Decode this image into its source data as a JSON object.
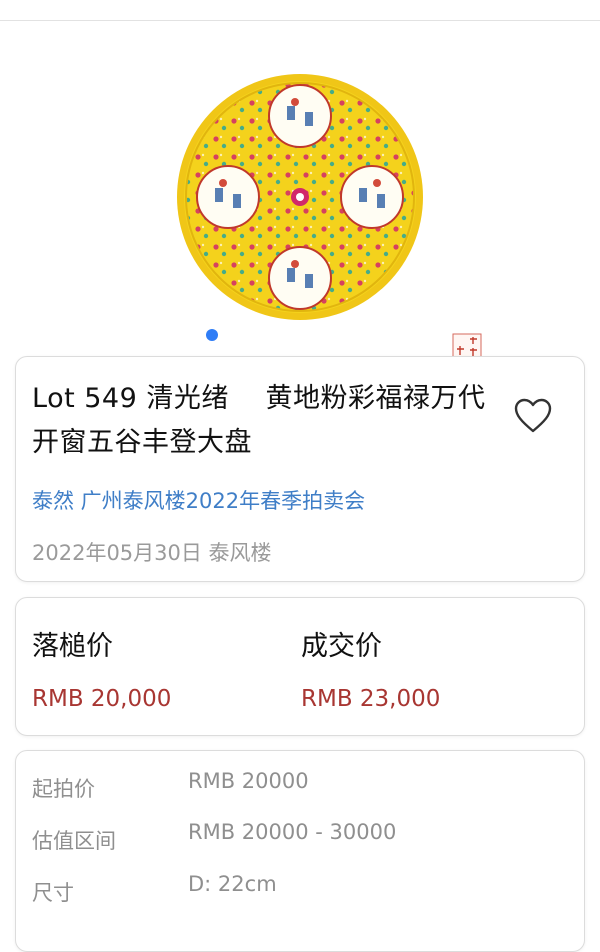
{
  "carousel": {
    "image_icon": "porcelain-plate-image",
    "seal_icon": "reign-mark-seal"
  },
  "lot": {
    "title": "Lot 549 清光绪　 黄地粉彩福禄万代开窗五谷丰登大盘",
    "auction_name": "泰然 广州泰风楼2022年春季拍卖会",
    "date_house": "2022年05月30日 泰风楼",
    "favorite_icon": "heart-icon"
  },
  "prices": {
    "hammer_label": "落槌价",
    "hammer_value": "RMB 20,000",
    "deal_label": "成交价",
    "deal_value": "RMB 23,000",
    "value_color": "#a83632"
  },
  "details": {
    "rows": [
      {
        "label": "起拍价",
        "value": "RMB 20000"
      },
      {
        "label": "估值区间",
        "value": "RMB 20000 - 30000"
      },
      {
        "label": "尺寸",
        "value": "D: 22cm"
      }
    ]
  },
  "colors": {
    "link": "#3f7ec7",
    "accent_dot": "#2f7df6",
    "plate_yellow": "#f3cf18"
  }
}
